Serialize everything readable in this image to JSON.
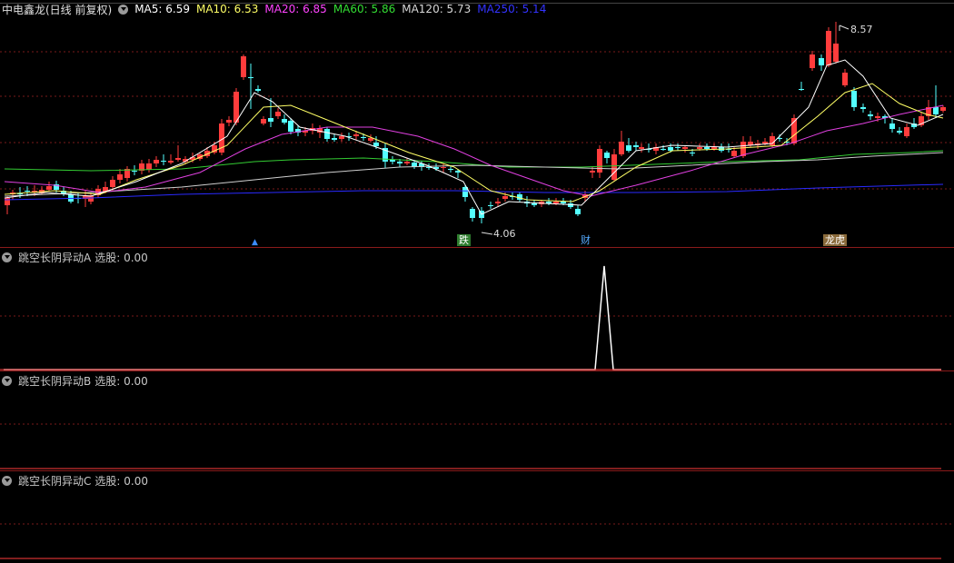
{
  "main": {
    "stock_title": "中电鑫龙(日线 前复权)",
    "ma_labels": [
      {
        "text": "MA5: 6.59",
        "color": "#ffffff"
      },
      {
        "text": "MA10: 6.53",
        "color": "#ffff66"
      },
      {
        "text": "MA20: 6.85",
        "color": "#ff44ff"
      },
      {
        "text": "MA60: 5.86",
        "color": "#33dd33"
      },
      {
        "text": "MA120: 5.73",
        "color": "#d8d8d8"
      },
      {
        "text": "MA250: 5.14",
        "color": "#3333ff"
      }
    ],
    "high_label": "8.57",
    "low_label": "4.06",
    "markers": [
      {
        "text": "跌",
        "bg": "#2e7d2e",
        "color": "#ffffff"
      },
      {
        "text": "财",
        "bg": "#000000",
        "color": "#55aaff"
      },
      {
        "text": "龙虎",
        "bg": "#8a6a3a",
        "color": "#ffffff"
      }
    ],
    "colors": {
      "up": "#ff3c3c",
      "down": "#54ffff",
      "grid": "#7a1a1a"
    }
  },
  "indicators": [
    {
      "name": "跳空长阴异动A",
      "field": "选股: 0.00"
    },
    {
      "name": "跳空长阴异动B",
      "field": "选股: 0.00"
    },
    {
      "name": "跳空长阴异动C",
      "field": "选股: 0.00"
    }
  ]
}
